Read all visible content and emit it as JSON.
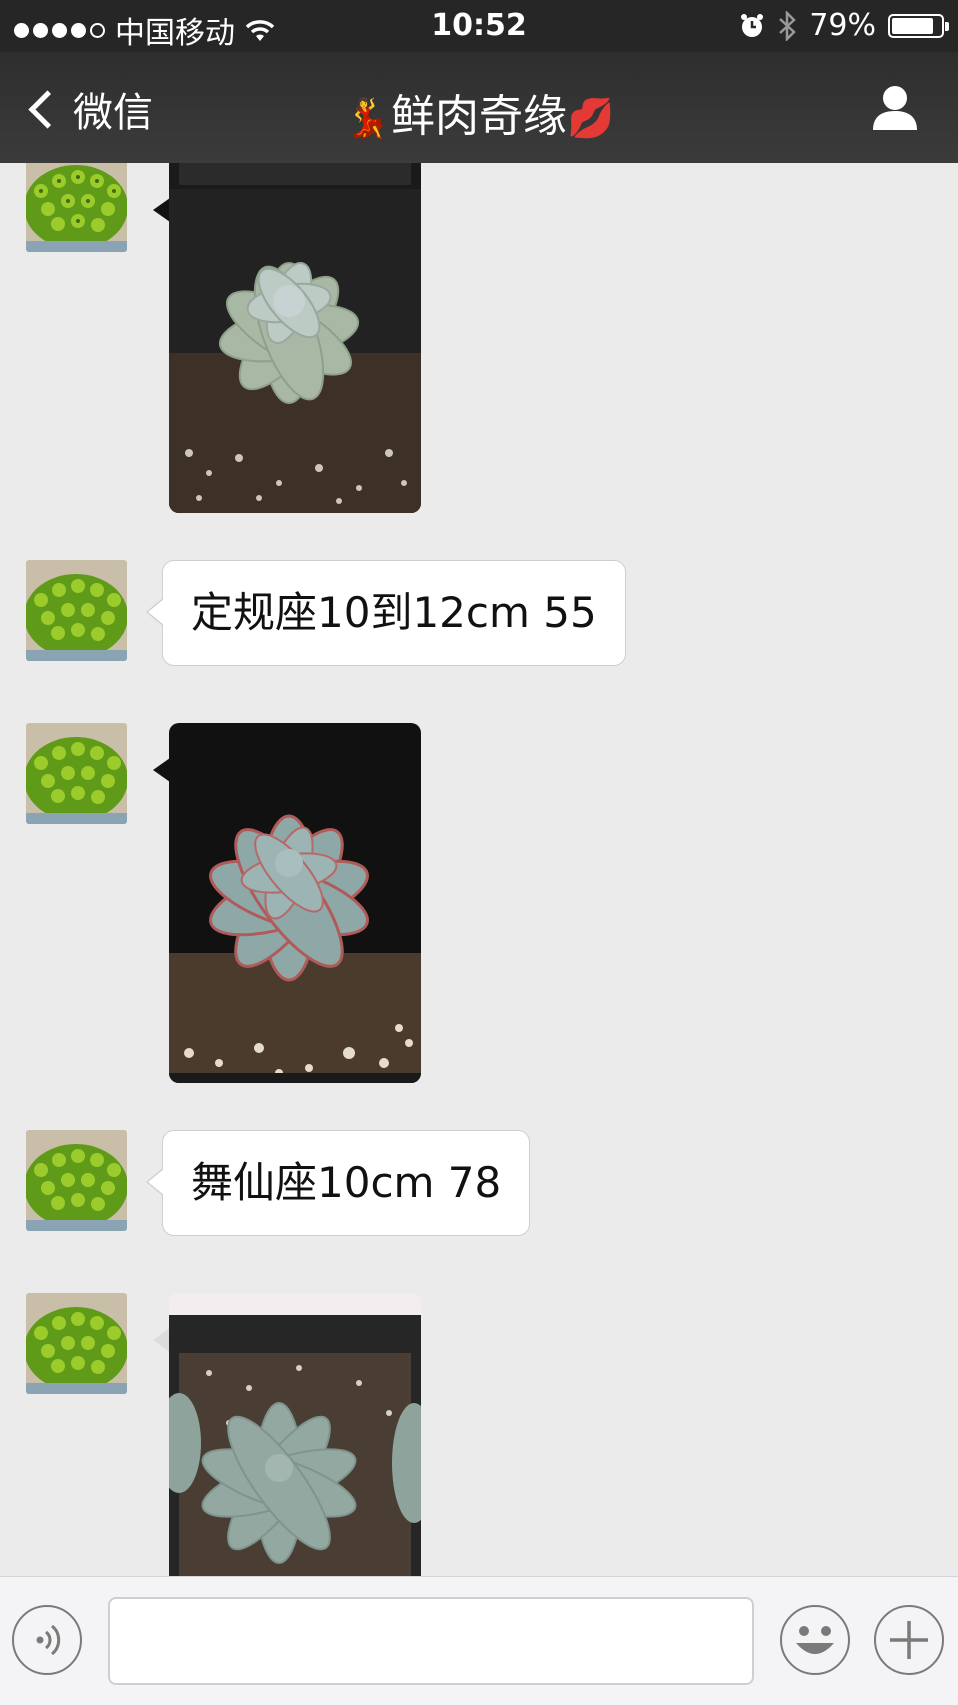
{
  "status_bar": {
    "carrier": "中国移动",
    "time": "10:52",
    "battery": "79%",
    "battery_level": 0.79,
    "signal_bars": 4,
    "icons": [
      "wifi-icon",
      "alarm-icon",
      "bluetooth-icon",
      "battery-icon"
    ]
  },
  "nav": {
    "back_label": "微信",
    "title_emoji_left": "💃",
    "title": "鲜肉奇缘",
    "title_emoji_right": "💋",
    "right_icon": "person-icon"
  },
  "messages": [
    {
      "type": "image",
      "desc": "succulent-photo"
    },
    {
      "type": "text",
      "text": "定规座10到12cm 55"
    },
    {
      "type": "image",
      "desc": "succulent-photo"
    },
    {
      "type": "text",
      "text": "舞仙座10cm 78"
    },
    {
      "type": "image",
      "desc": "succulent-photo"
    }
  ],
  "input_bar": {
    "voice_icon": "voice-icon",
    "input_value": "",
    "emoji_icon": "emoji-icon",
    "plus_icon": "plus-icon"
  },
  "colors": {
    "header_bg": "#2e2e2e",
    "chat_bg": "#ebebeb",
    "bubble_bg": "#ffffff"
  }
}
